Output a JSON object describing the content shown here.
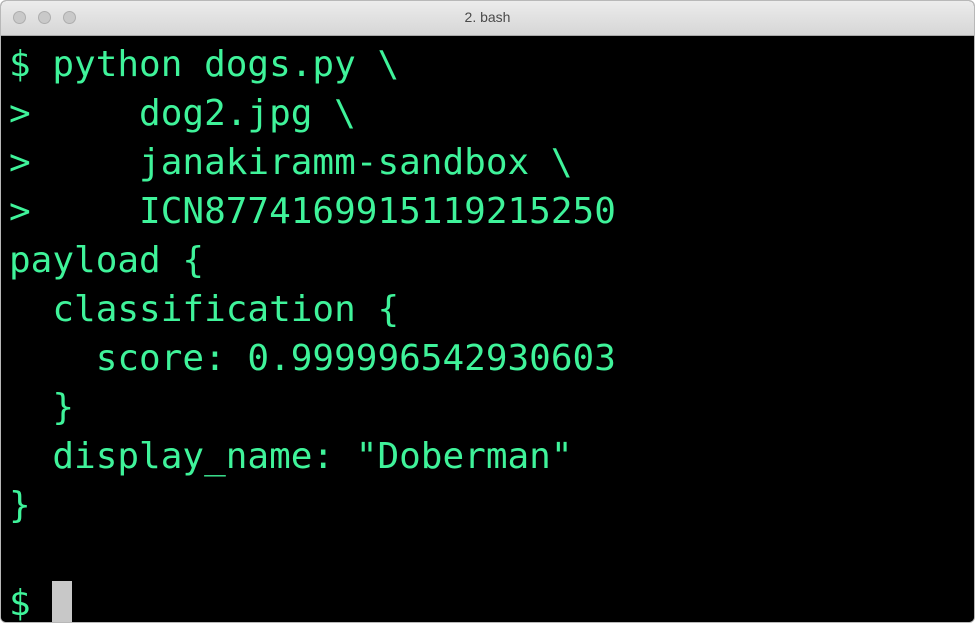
{
  "window": {
    "title": "2. bash"
  },
  "terminal": {
    "lines": [
      "$ python dogs.py \\",
      ">     dog2.jpg \\",
      ">     janakiramm-sandbox \\",
      ">     ICN8774169915119215250",
      "payload {",
      "  classification {",
      "    score: 0.999996542930603",
      "  }",
      "  display_name: \"Doberman\"",
      "}",
      "",
      "$ "
    ],
    "text_color": "#3ff39a",
    "background_color": "#000000"
  }
}
